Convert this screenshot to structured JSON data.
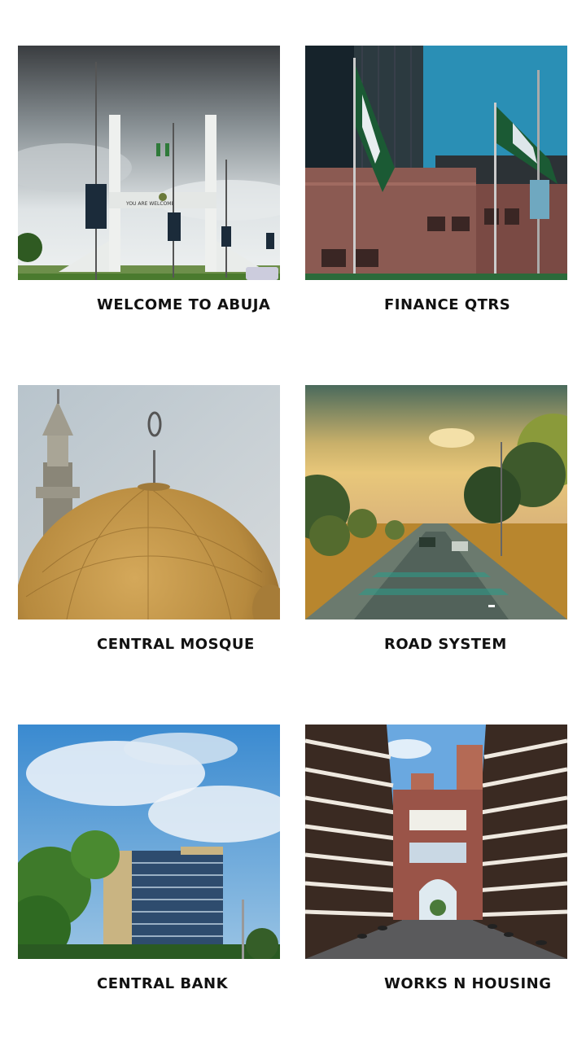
{
  "gallery": {
    "items": [
      {
        "caption": "WELCOME TO ABUJA",
        "sign_text": "YOU ARE    WELCOME",
        "image_subject": "city gate"
      },
      {
        "caption": "FINANCE QTRS",
        "image_subject": "office buildings with flags"
      },
      {
        "caption": "CENTRAL MOSQUE",
        "image_subject": "golden dome and minaret"
      },
      {
        "caption": "ROAD SYSTEM",
        "image_subject": "tree lined road at sunset"
      },
      {
        "caption": "CENTRAL BANK",
        "image_subject": "tower under cloudy sky"
      },
      {
        "caption": "WORKS N HOUSING",
        "image_subject": "housing blocks with arch"
      }
    ]
  }
}
